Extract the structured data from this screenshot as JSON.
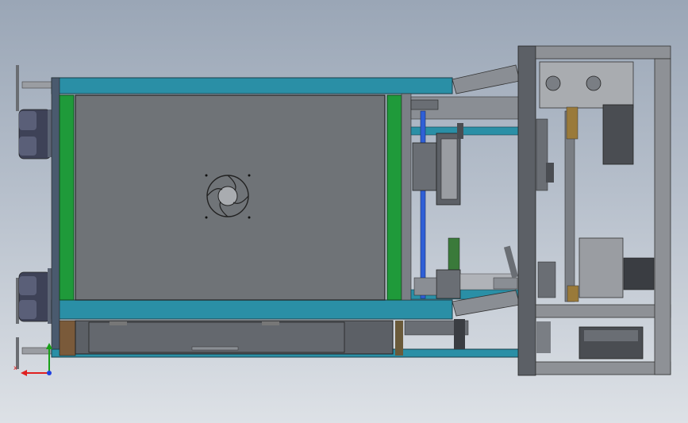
{
  "viewport": {
    "background_top": "#9aa6b6",
    "background_bottom": "#dde1e6"
  },
  "model": {
    "frame_color": "#2a8fa6",
    "plate_color": "#6f7377",
    "green_rail_color": "#1f9a3a",
    "dark_part_color": "#3d4150",
    "blue_rod_color": "#2f5fd6",
    "aluminum_color": "#8e9196"
  },
  "triad": {
    "x_axis_color": "#e02020",
    "y_axis_color": "#18a018",
    "z_axis_color": "#2040e0",
    "x_label": "x"
  }
}
